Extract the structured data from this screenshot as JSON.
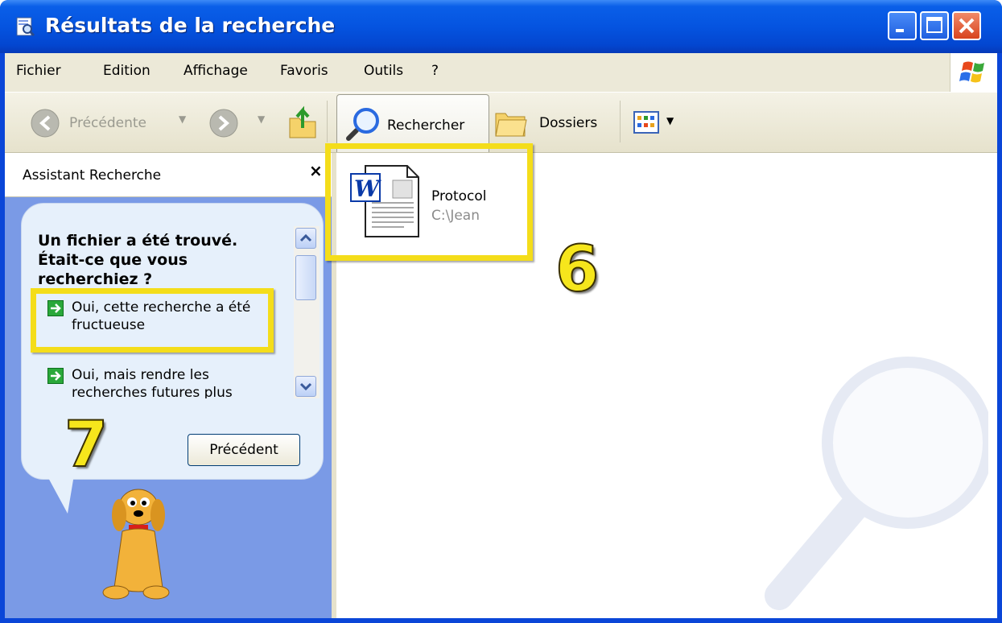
{
  "window": {
    "title": "Résultats de la recherche"
  },
  "menu": [
    "Fichier",
    "Edition",
    "Affichage",
    "Favoris",
    "Outils",
    "?"
  ],
  "toolbar": {
    "back_label": "Précédente",
    "search_label": "Rechercher",
    "folders_label": "Dossiers"
  },
  "assistant": {
    "title": "Assistant Recherche",
    "close_glyph": "×",
    "heading": "Un fichier a été trouvé. Était-ce que vous recherchiez ?",
    "option1": "Oui, cette recherche a été fructueuse",
    "option2": "Oui, mais rendre les recherches futures plus",
    "prev_button": "Précédent"
  },
  "results": {
    "file_name": "Protocol",
    "file_path": "C:\\Jean"
  },
  "annotations": {
    "marker_6": "6",
    "marker_7": "7"
  },
  "colors": {
    "titlebar": "#0554e0",
    "menubar": "#ece9d8",
    "leftpane": "#7a9ae6",
    "highlight": "#f4dd1a"
  },
  "icons": [
    "window-icon",
    "minimize-icon",
    "maximize-icon",
    "close-icon",
    "windows-logo-icon",
    "back-arrow-icon",
    "forward-arrow-icon",
    "up-folder-icon",
    "search-icon",
    "folders-icon",
    "views-icon",
    "arrow-right-icon",
    "word-document-icon",
    "dog-assistant-icon",
    "magnifier-watermark-icon"
  ]
}
